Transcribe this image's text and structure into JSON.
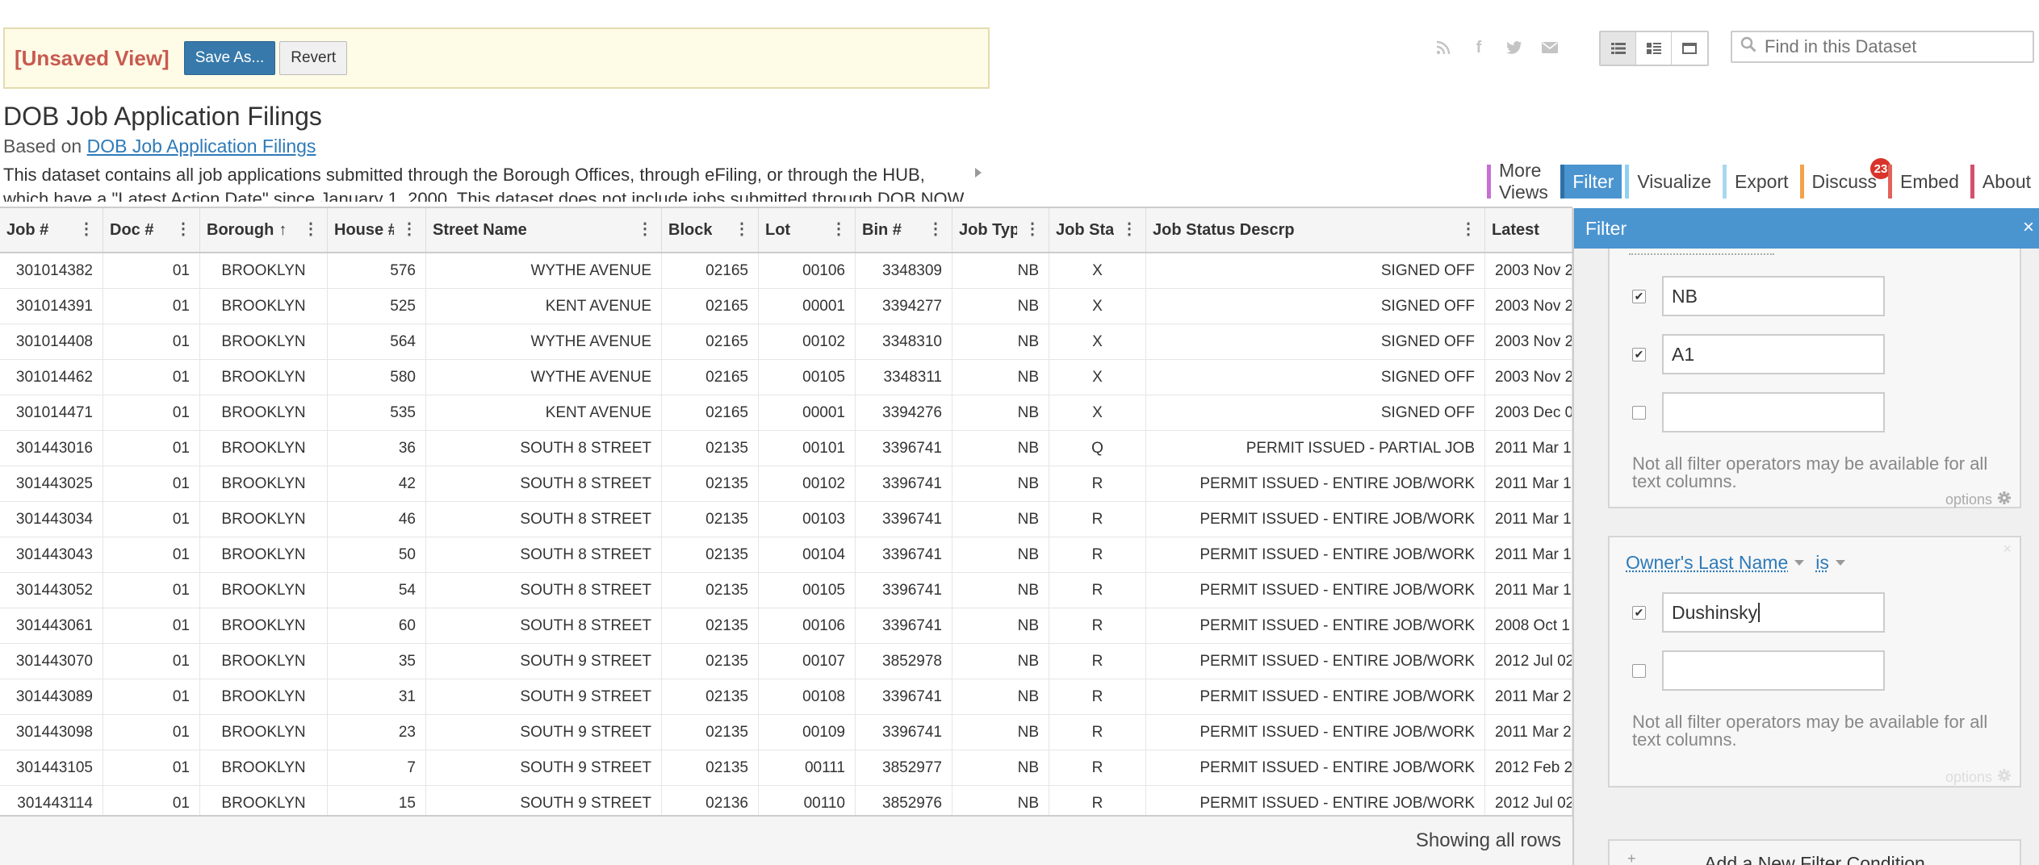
{
  "banner": {
    "title": "[Unsaved View]",
    "save_as": "Save As...",
    "revert": "Revert"
  },
  "social_icons": [
    "rss-icon",
    "facebook-icon",
    "twitter-icon",
    "email-icon"
  ],
  "view_toggle": [
    "grid-view-icon",
    "list-view-icon",
    "page-view-icon"
  ],
  "search": {
    "placeholder": "Find in this Dataset"
  },
  "dataset": {
    "title": "DOB Job Application Filings",
    "based_on_prefix": "Based on",
    "based_on_link": "DOB Job Application Filings",
    "description": "This dataset contains all job applications submitted through the Borough Offices, through eFiling, or through the HUB, which have a \"Latest Action Date\" since January 1, 2000. This dataset does not include jobs submitted through DOB NOW."
  },
  "tabs": [
    {
      "label": "More Views",
      "color": "#c86fd3"
    },
    {
      "label": "Filter",
      "color": "#2f6fa8",
      "active": true
    },
    {
      "label": "Visualize",
      "color": "#8fd0ef"
    },
    {
      "label": "Export",
      "color": "#a8d8f0"
    },
    {
      "label": "Discuss",
      "color": "#f3a24a",
      "badge": "23"
    },
    {
      "label": "Embed",
      "color": "#e2625a"
    },
    {
      "label": "About",
      "color": "#d5506e"
    }
  ],
  "grid": {
    "columns": [
      {
        "label": "Job #"
      },
      {
        "label": "Doc #"
      },
      {
        "label": "Borough",
        "sorted": "↑"
      },
      {
        "label": "House #"
      },
      {
        "label": "Street Name"
      },
      {
        "label": "Block"
      },
      {
        "label": "Lot"
      },
      {
        "label": "Bin #"
      },
      {
        "label": "Job Type"
      },
      {
        "label": "Job Status"
      },
      {
        "label": "Job Status Descrp"
      },
      {
        "label": "Latest Action Date"
      }
    ],
    "rows": [
      [
        "301014382",
        "01",
        "BROOKLYN",
        "576",
        "WYTHE AVENUE",
        "02165",
        "00106",
        "3348309",
        "NB",
        "X",
        "SIGNED OFF",
        "2003 Nov 2"
      ],
      [
        "301014391",
        "01",
        "BROOKLYN",
        "525",
        "KENT AVENUE",
        "02165",
        "00001",
        "3394277",
        "NB",
        "X",
        "SIGNED OFF",
        "2003 Nov 2"
      ],
      [
        "301014408",
        "01",
        "BROOKLYN",
        "564",
        "WYTHE AVENUE",
        "02165",
        "00102",
        "3348310",
        "NB",
        "X",
        "SIGNED OFF",
        "2003 Nov 2"
      ],
      [
        "301014462",
        "01",
        "BROOKLYN",
        "580",
        "WYTHE AVENUE",
        "02165",
        "00105",
        "3348311",
        "NB",
        "X",
        "SIGNED OFF",
        "2003 Nov 2"
      ],
      [
        "301014471",
        "01",
        "BROOKLYN",
        "535",
        "KENT AVENUE",
        "02165",
        "00001",
        "3394276",
        "NB",
        "X",
        "SIGNED OFF",
        "2003 Dec 0"
      ],
      [
        "301443016",
        "01",
        "BROOKLYN",
        "36",
        "SOUTH 8 STREET",
        "02135",
        "00101",
        "3396741",
        "NB",
        "Q",
        "PERMIT ISSUED - PARTIAL JOB",
        "2011 Mar 1"
      ],
      [
        "301443025",
        "01",
        "BROOKLYN",
        "42",
        "SOUTH 8 STREET",
        "02135",
        "00102",
        "3396741",
        "NB",
        "R",
        "PERMIT ISSUED - ENTIRE JOB/WORK",
        "2011 Mar 1"
      ],
      [
        "301443034",
        "01",
        "BROOKLYN",
        "46",
        "SOUTH 8 STREET",
        "02135",
        "00103",
        "3396741",
        "NB",
        "R",
        "PERMIT ISSUED - ENTIRE JOB/WORK",
        "2011 Mar 1"
      ],
      [
        "301443043",
        "01",
        "BROOKLYN",
        "50",
        "SOUTH 8 STREET",
        "02135",
        "00104",
        "3396741",
        "NB",
        "R",
        "PERMIT ISSUED - ENTIRE JOB/WORK",
        "2011 Mar 1"
      ],
      [
        "301443052",
        "01",
        "BROOKLYN",
        "54",
        "SOUTH 8 STREET",
        "02135",
        "00105",
        "3396741",
        "NB",
        "R",
        "PERMIT ISSUED - ENTIRE JOB/WORK",
        "2011 Mar 1"
      ],
      [
        "301443061",
        "01",
        "BROOKLYN",
        "60",
        "SOUTH 8 STREET",
        "02135",
        "00106",
        "3396741",
        "NB",
        "R",
        "PERMIT ISSUED - ENTIRE JOB/WORK",
        "2008 Oct 1"
      ],
      [
        "301443070",
        "01",
        "BROOKLYN",
        "35",
        "SOUTH 9 STREET",
        "02135",
        "00107",
        "3852978",
        "NB",
        "R",
        "PERMIT ISSUED - ENTIRE JOB/WORK",
        "2012 Jul 02"
      ],
      [
        "301443089",
        "01",
        "BROOKLYN",
        "31",
        "SOUTH 9 STREET",
        "02135",
        "00108",
        "3396741",
        "NB",
        "R",
        "PERMIT ISSUED - ENTIRE JOB/WORK",
        "2011 Mar 2"
      ],
      [
        "301443098",
        "01",
        "BROOKLYN",
        "23",
        "SOUTH 9 STREET",
        "02135",
        "00109",
        "3396741",
        "NB",
        "R",
        "PERMIT ISSUED - ENTIRE JOB/WORK",
        "2011 Mar 2"
      ],
      [
        "301443105",
        "01",
        "BROOKLYN",
        "7",
        "SOUTH 9 STREET",
        "02135",
        "00111",
        "3852977",
        "NB",
        "R",
        "PERMIT ISSUED - ENTIRE JOB/WORK",
        "2012 Feb 2"
      ],
      [
        "301443114",
        "01",
        "BROOKLYN",
        "15",
        "SOUTH 9 STREET",
        "02136",
        "00110",
        "3852976",
        "NB",
        "R",
        "PERMIT ISSUED - ENTIRE JOB/WORK",
        "2012 Jul 02"
      ]
    ],
    "footer": "Showing all rows"
  },
  "filter_panel": {
    "title": "Filter",
    "close": "×",
    "card1": {
      "values": [
        {
          "checked": true,
          "value": "NB"
        },
        {
          "checked": true,
          "value": "A1"
        },
        {
          "checked": false,
          "value": ""
        }
      ],
      "note": "Not all filter operators may be available for all text columns.",
      "options": "options"
    },
    "card2": {
      "column": "Owner's Last Name",
      "operator": "is",
      "values": [
        {
          "checked": true,
          "value": "Dushinsky"
        },
        {
          "checked": false,
          "value": ""
        }
      ],
      "note": "Not all filter operators may be available for all text columns.",
      "options": "options"
    },
    "add_condition": "Add a New Filter Condition"
  }
}
